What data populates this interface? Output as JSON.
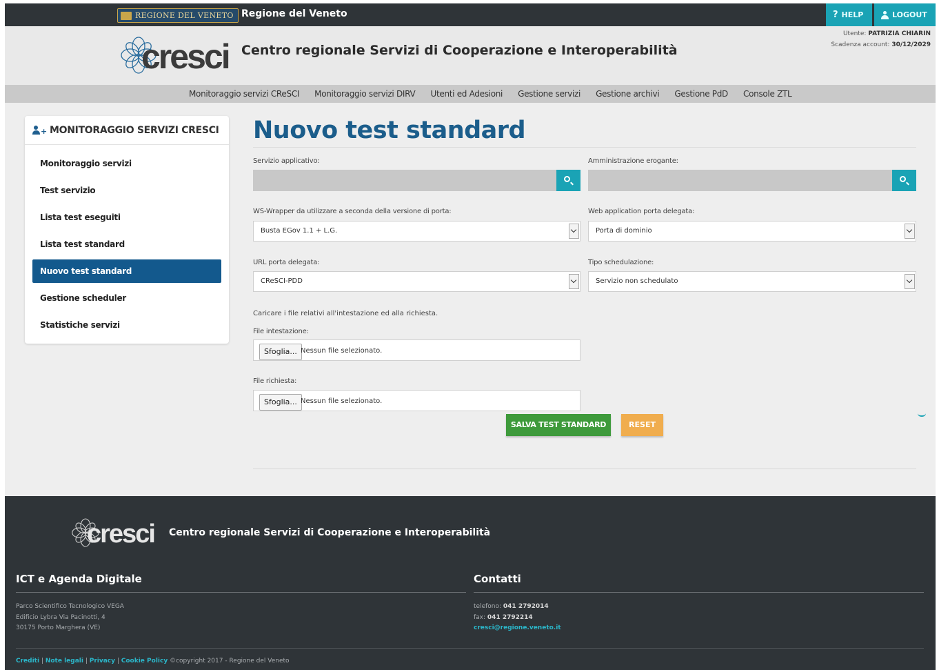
{
  "topbar": {
    "badge_label": "REGIONE DEL VENETO",
    "title": "Regione del Veneto",
    "help_label": "HELP",
    "logout_label": "LOGOUT"
  },
  "header": {
    "logo_word": "cresci",
    "title": "Centro regionale Servizi di Cooperazione e Interoperabilità",
    "user_label": "Utente:",
    "user_name": "PATRIZIA CHIARIN",
    "expiry_label": "Scadenza account:",
    "expiry_date": "30/12/2029"
  },
  "nav": {
    "items": [
      "Monitoraggio servizi CReSCI",
      "Monitoraggio servizi DIRV",
      "Utenti ed Adesioni",
      "Gestione servizi",
      "Gestione archivi",
      "Gestione PdD",
      "Console ZTL"
    ]
  },
  "sidebar": {
    "title": "MONITORAGGIO SERVIZI CRESCI",
    "items": [
      {
        "label": "Monitoraggio servizi",
        "active": false
      },
      {
        "label": "Test servizio",
        "active": false
      },
      {
        "label": "Lista test eseguiti",
        "active": false
      },
      {
        "label": "Lista test standard",
        "active": false
      },
      {
        "label": "Nuovo test standard",
        "active": true
      },
      {
        "label": "Gestione scheduler",
        "active": false
      },
      {
        "label": "Statistiche servizi",
        "active": false
      }
    ]
  },
  "form": {
    "page_title": "Nuovo test standard",
    "servizio_label": "Servizio applicativo:",
    "amministrazione_label": "Amministrazione erogante:",
    "wrapper_label": "WS-Wrapper da utilizzare a seconda della versione di porta:",
    "wrapper_value": "Busta EGov 1.1 + L.G.",
    "webapp_label": "Web application porta delegata:",
    "webapp_value": "Porta di dominio",
    "url_label": "URL porta delegata:",
    "url_value": "CReSCI-PDD",
    "sched_label": "Tipo schedulazione:",
    "sched_value": "Servizio non schedulato",
    "instructions": "Caricare i file relativi all'intestazione ed alla richiesta.",
    "file_intestazione_label": "File intestazione:",
    "file_richiesta_label": "File richiesta:",
    "browse_label": "Sfoglia...",
    "no_file_label": "Nessun file selezionato.",
    "save_label": "SALVA TEST STANDARD",
    "reset_label": "RESET"
  },
  "footer": {
    "logo_word": "cresci",
    "title": "Centro regionale Servizi di Cooperazione e Interoperabilità",
    "ict_title": "ICT e Agenda Digitale",
    "address_lines": [
      "Parco Scientifico Tecnologico VEGA",
      "Edificio Lybra Via Pacinotti, 4",
      "30175 Porto Marghera (VE)"
    ],
    "contacts_title": "Contatti",
    "phone_label": "telefono:",
    "phone": "041 2792014",
    "fax_label": "fax:",
    "fax": "041 2792214",
    "email": "cresci@regione.veneto.it",
    "links": [
      "Crediti",
      "Note legali",
      "Privacy",
      "Cookie Policy"
    ],
    "copyright": "©copyright 2017 - Regione del Veneto"
  },
  "colors": {
    "primary": "#13598d",
    "accent": "#1aa3b5",
    "save": "#3e9a3b",
    "reset": "#f0ad4e",
    "dark": "#2f3438"
  }
}
